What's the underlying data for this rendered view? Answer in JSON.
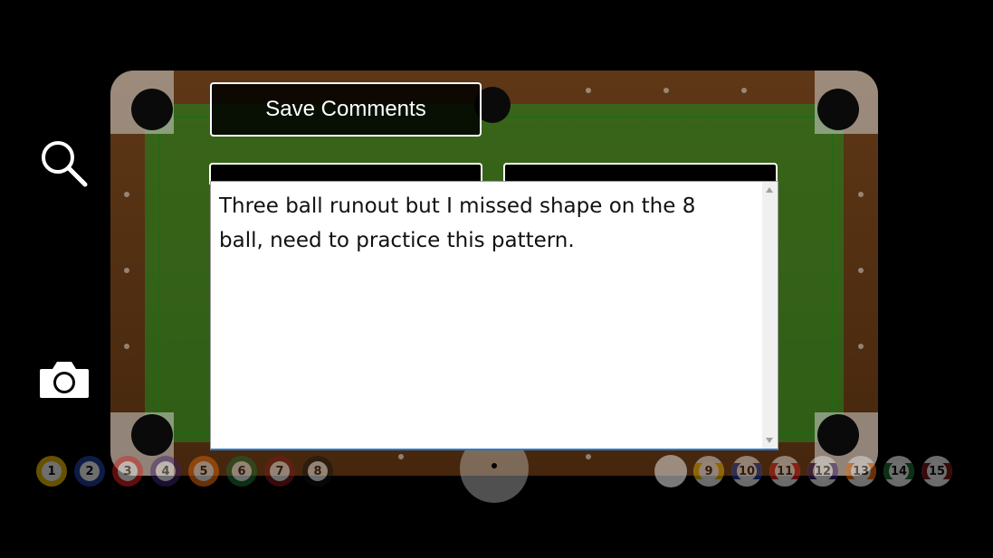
{
  "toolbar": {
    "save_label": "Save Comments",
    "icons": [
      "search-icon",
      "camera-icon"
    ]
  },
  "comment": {
    "text": "Three ball runout but I missed shape on the 8 ball, need to practice this pattern."
  },
  "ball_strip": {
    "solids": [
      {
        "num": "1",
        "color": "#e3b400"
      },
      {
        "num": "2",
        "color": "#1f3d9a"
      },
      {
        "num": "3",
        "color": "#d21f1f"
      },
      {
        "num": "4",
        "color": "#3b1f6e"
      },
      {
        "num": "5",
        "color": "#e86a0f"
      },
      {
        "num": "6",
        "color": "#1b6b2e"
      },
      {
        "num": "7",
        "color": "#7a1a1a"
      },
      {
        "num": "8",
        "color": "#111111"
      }
    ],
    "stripes": [
      {
        "num": "9",
        "color": "#e3b400"
      },
      {
        "num": "10",
        "color": "#1f3d9a"
      },
      {
        "num": "11",
        "color": "#d21f1f"
      },
      {
        "num": "12",
        "color": "#3b1f6e"
      },
      {
        "num": "13",
        "color": "#e86a0f"
      },
      {
        "num": "14",
        "color": "#1b6b2e"
      },
      {
        "num": "15",
        "color": "#7a1a1a"
      }
    ]
  },
  "colors": {
    "cloth": "#1e8a1e",
    "rail": "#6a3d17",
    "textarea_focus": "#2a7bd0"
  }
}
